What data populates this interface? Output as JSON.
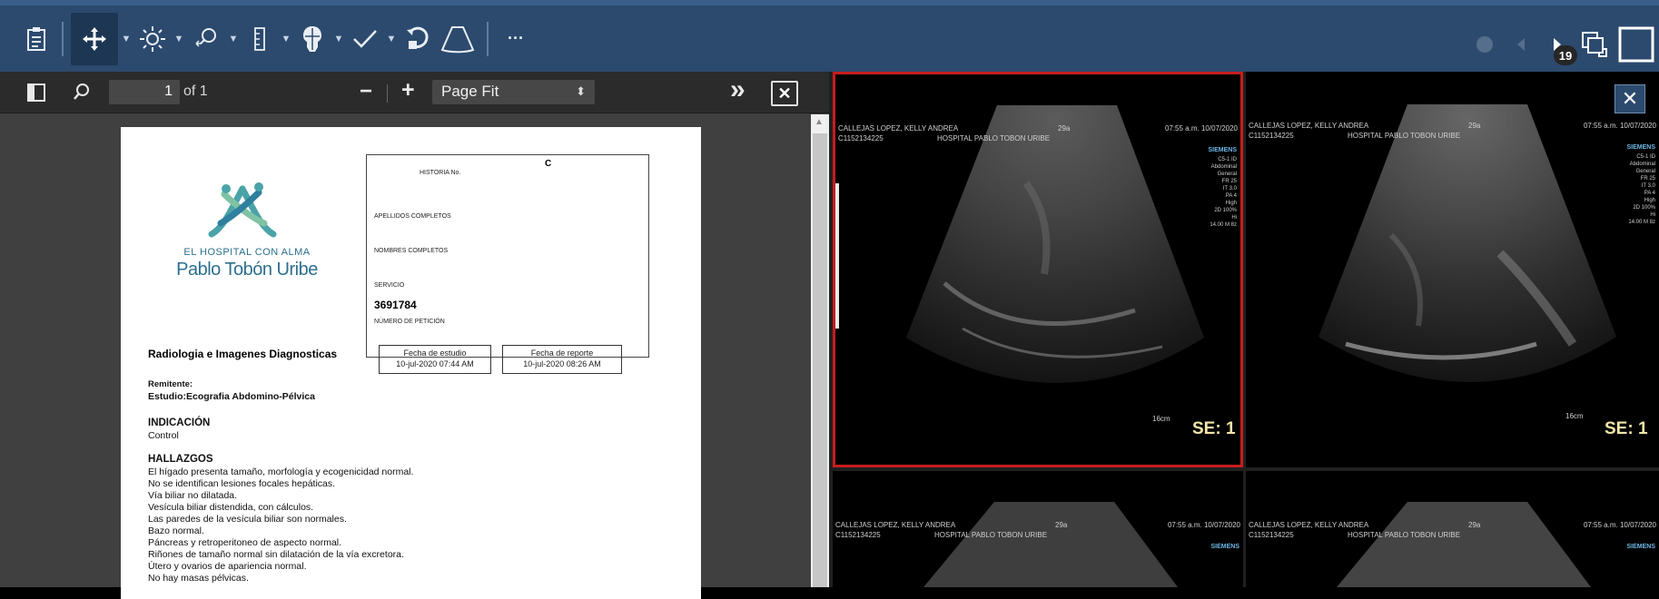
{
  "toolbar": {
    "tools": [
      "report-icon",
      "pan-icon",
      "brightness-icon",
      "magnify-icon",
      "ruler-icon",
      "anatomy-icon",
      "mpr-icon",
      "check-icon",
      "reset-icon",
      "ultrasound-icon"
    ],
    "more_label": "···",
    "series_count": "19"
  },
  "pdf": {
    "page_value": "1",
    "page_of": "of 1",
    "zoom_out": "−",
    "zoom_in": "+",
    "zoom_select": "Page Fit",
    "more": "»",
    "close": "✕"
  },
  "report": {
    "logo_line1": "EL HOSPITAL CON ALMA",
    "logo_line2": "Pablo Tobón Uribe",
    "id_box": {
      "c": "C",
      "historia": "HISTORIA No.",
      "apellidos": "APELLIDOS COMPLETOS",
      "nombres": "NOMBRES COMPLETOS",
      "servicio": "SERVICIO",
      "numero": "3691784",
      "numero_label": "NÚMERO DE PETICIÓN"
    },
    "department": "Radiologia e Imagenes Diagnosticas",
    "fecha_estudio_label": "Fecha de estudio",
    "fecha_estudio": "10-jul-2020 07:44 AM",
    "fecha_reporte_label": "Fecha de reporte",
    "fecha_reporte": "10-jul-2020 08:26 AM",
    "remitente": "Remitente:",
    "estudio": "Estudio:Ecografia Abdomino-Pélvica",
    "indicacion_h": "INDICACIÓN",
    "indicacion": "Control",
    "hallazgos_h": "HALLAZGOS",
    "hallazgos": [
      "El hígado presenta tamaño, morfología y ecogenicidad normal.",
      "No se identifican lesiones focales hepáticas.",
      "Vía biliar no dilatada.",
      "Vesícula biliar distendida, con cálculos.",
      "Las paredes de la vesícula biliar son normales.",
      "Bazo normal.",
      "Páncreas y retroperitoneo de aspecto normal.",
      "Riñones de tamaño normal sin dilatación de la vía excretora.",
      "Útero y ovarios de apariencia normal.",
      "No hay masas pélvicas."
    ]
  },
  "viewer": {
    "close": "✕",
    "patient_name": "CALLEJAS LOPEZ, KELLY ANDREA",
    "age": "29a",
    "patient_id": "C1152134225",
    "institution": "HOSPITAL PABLO TOBON URIBE",
    "datetime": "07:55 a.m. 10/07/2020",
    "vendor": "SIEMENS",
    "depth": "16cm",
    "series_label": "SE: 1",
    "colors": {
      "selected_border": "#c61d1d",
      "series_text": "#f2e6a8",
      "vendor": "#6fb7e8"
    }
  }
}
